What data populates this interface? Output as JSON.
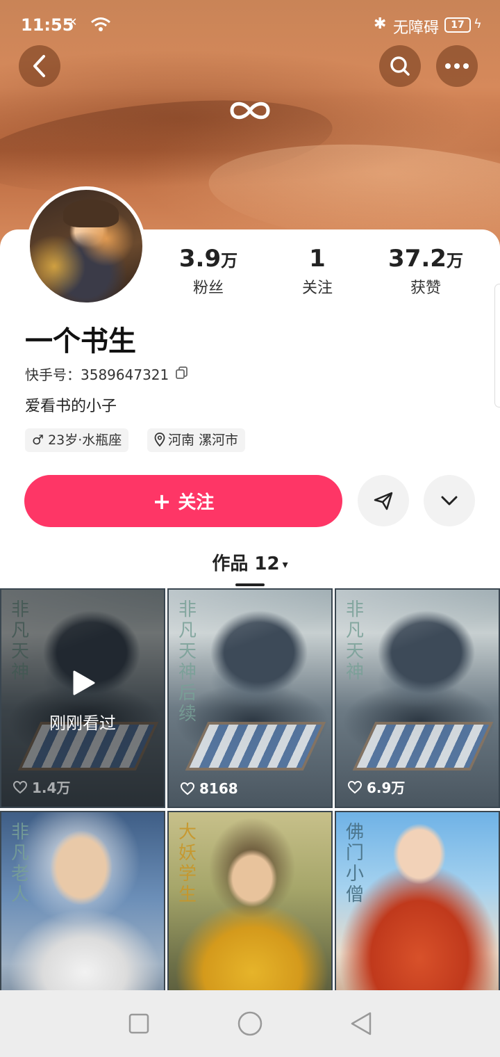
{
  "status_bar": {
    "time": "11:55",
    "signal": "✕",
    "bluetooth": "✱",
    "accessibility_label": "无障碍",
    "battery": "17"
  },
  "header": {
    "back_icon": "chevron-left-icon",
    "search_icon": "search-icon",
    "more_icon": "more-dots-icon",
    "brand_icon": "infinity-icon"
  },
  "profile": {
    "name": "一个书生",
    "kuaishou_id_label": "快手号：",
    "kuaishou_id": "3589647321",
    "bio": "爱看书的小子",
    "tags": {
      "age": "♂ 23岁·水瓶座",
      "location": "河南 漯河市"
    }
  },
  "stats": {
    "fans": {
      "value": "3.9",
      "unit": "万",
      "label": "粉丝"
    },
    "following": {
      "value": "1",
      "unit": "",
      "label": "关注"
    },
    "likes": {
      "value": "37.2",
      "unit": "万",
      "label": "获赞"
    }
  },
  "actions": {
    "follow_plus": "+",
    "follow_label": "关注",
    "share_icon": "send-icon",
    "more_icon": "chevron-down-icon"
  },
  "tabs": {
    "works_label": "作品 12",
    "caret": "▾"
  },
  "videos": [
    {
      "title_text": "非凡天神",
      "likes": "1.4万",
      "overlay": "刚刚看过"
    },
    {
      "title_text": "非凡天神后续",
      "likes": "8168"
    },
    {
      "title_text": "非凡天神",
      "likes": "6.9万"
    },
    {
      "title_text": "非凡老人",
      "likes": ""
    },
    {
      "title_text": "大妖学生",
      "likes": ""
    },
    {
      "title_text": "佛门小僧",
      "likes": ""
    }
  ],
  "colors": {
    "accent": "#fe3666",
    "cover": "#d6895b"
  }
}
